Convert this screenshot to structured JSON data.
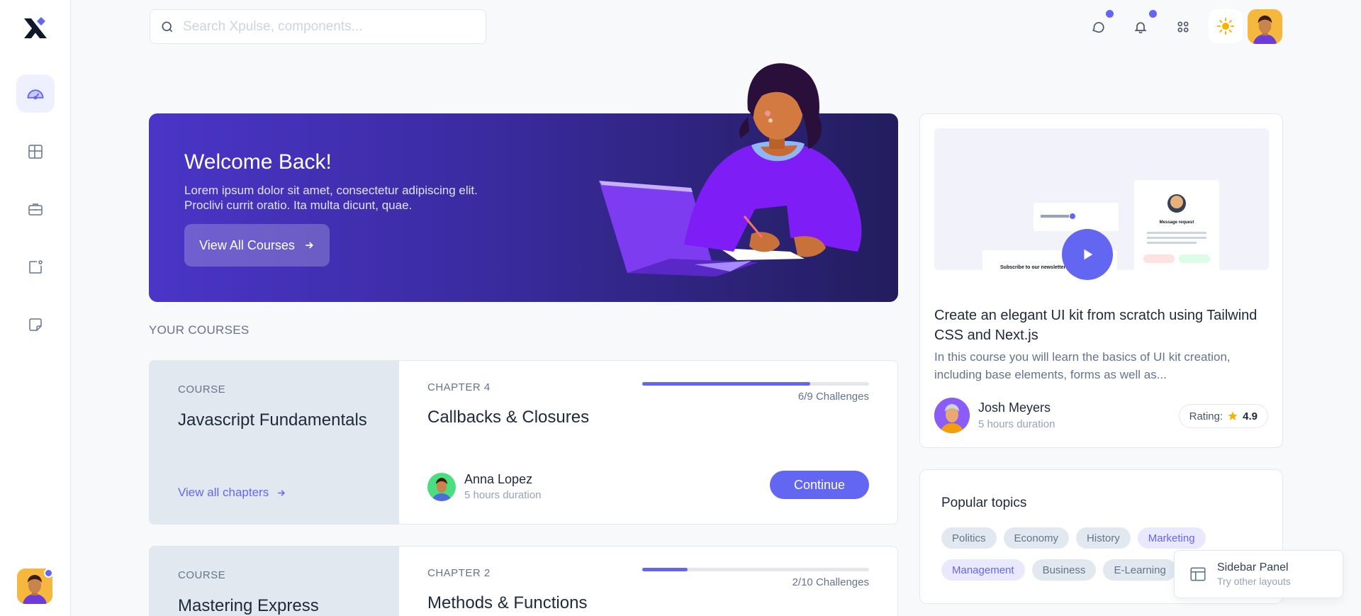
{
  "search": {
    "placeholder": "Search Xpulse, components..."
  },
  "hero": {
    "title": "Welcome Back!",
    "subtitle": "Lorem ipsum dolor sit amet, consectetur adipiscing elit. Proclivi currit oratio. Ita multa dicunt, quae.",
    "cta_label": "View All Courses"
  },
  "section": {
    "your_courses": "YOUR COURSES"
  },
  "courses": [
    {
      "tag": "COURSE",
      "title": "Javascript Fundamentals",
      "view_chapters": "View all chapters",
      "chapter": "CHAPTER 4",
      "lesson": "Callbacks & Closures",
      "progress": 0.74,
      "challenges": "6/9 Challenges",
      "author": "Anna Lopez",
      "duration": "5 hours duration",
      "button": "Continue"
    },
    {
      "tag": "COURSE",
      "title": "Mastering Express",
      "chapter": "CHAPTER 2",
      "lesson": "Methods & Functions",
      "progress": 0.2,
      "challenges": "2/10 Challenges"
    }
  ],
  "featured": {
    "title": "Create an elegant UI kit from scratch using Tailwind CSS and Next.js",
    "description": "In this course you will learn the basics of UI kit creation, including base elements, forms as well as...",
    "instructor": "Josh Meyers",
    "duration": "5 hours duration",
    "rating_label": "Rating:",
    "rating_value": "4.9",
    "preview": {
      "newsletter": "Subscribe to our newsletter",
      "message_request": "Message request"
    }
  },
  "topics": {
    "title": "Popular topics",
    "items": [
      {
        "label": "Politics",
        "accent": false
      },
      {
        "label": "Economy",
        "accent": false
      },
      {
        "label": "History",
        "accent": false
      },
      {
        "label": "Marketing",
        "accent": true
      },
      {
        "label": "Management",
        "accent": true
      },
      {
        "label": "Business",
        "accent": false
      },
      {
        "label": "E-Learning",
        "accent": false
      }
    ]
  },
  "toast": {
    "title": "Sidebar Panel",
    "subtitle": "Try other layouts"
  },
  "colors": {
    "accent": "#6366f1",
    "hero_start": "#4a35c7",
    "hero_end": "#231d5e"
  }
}
